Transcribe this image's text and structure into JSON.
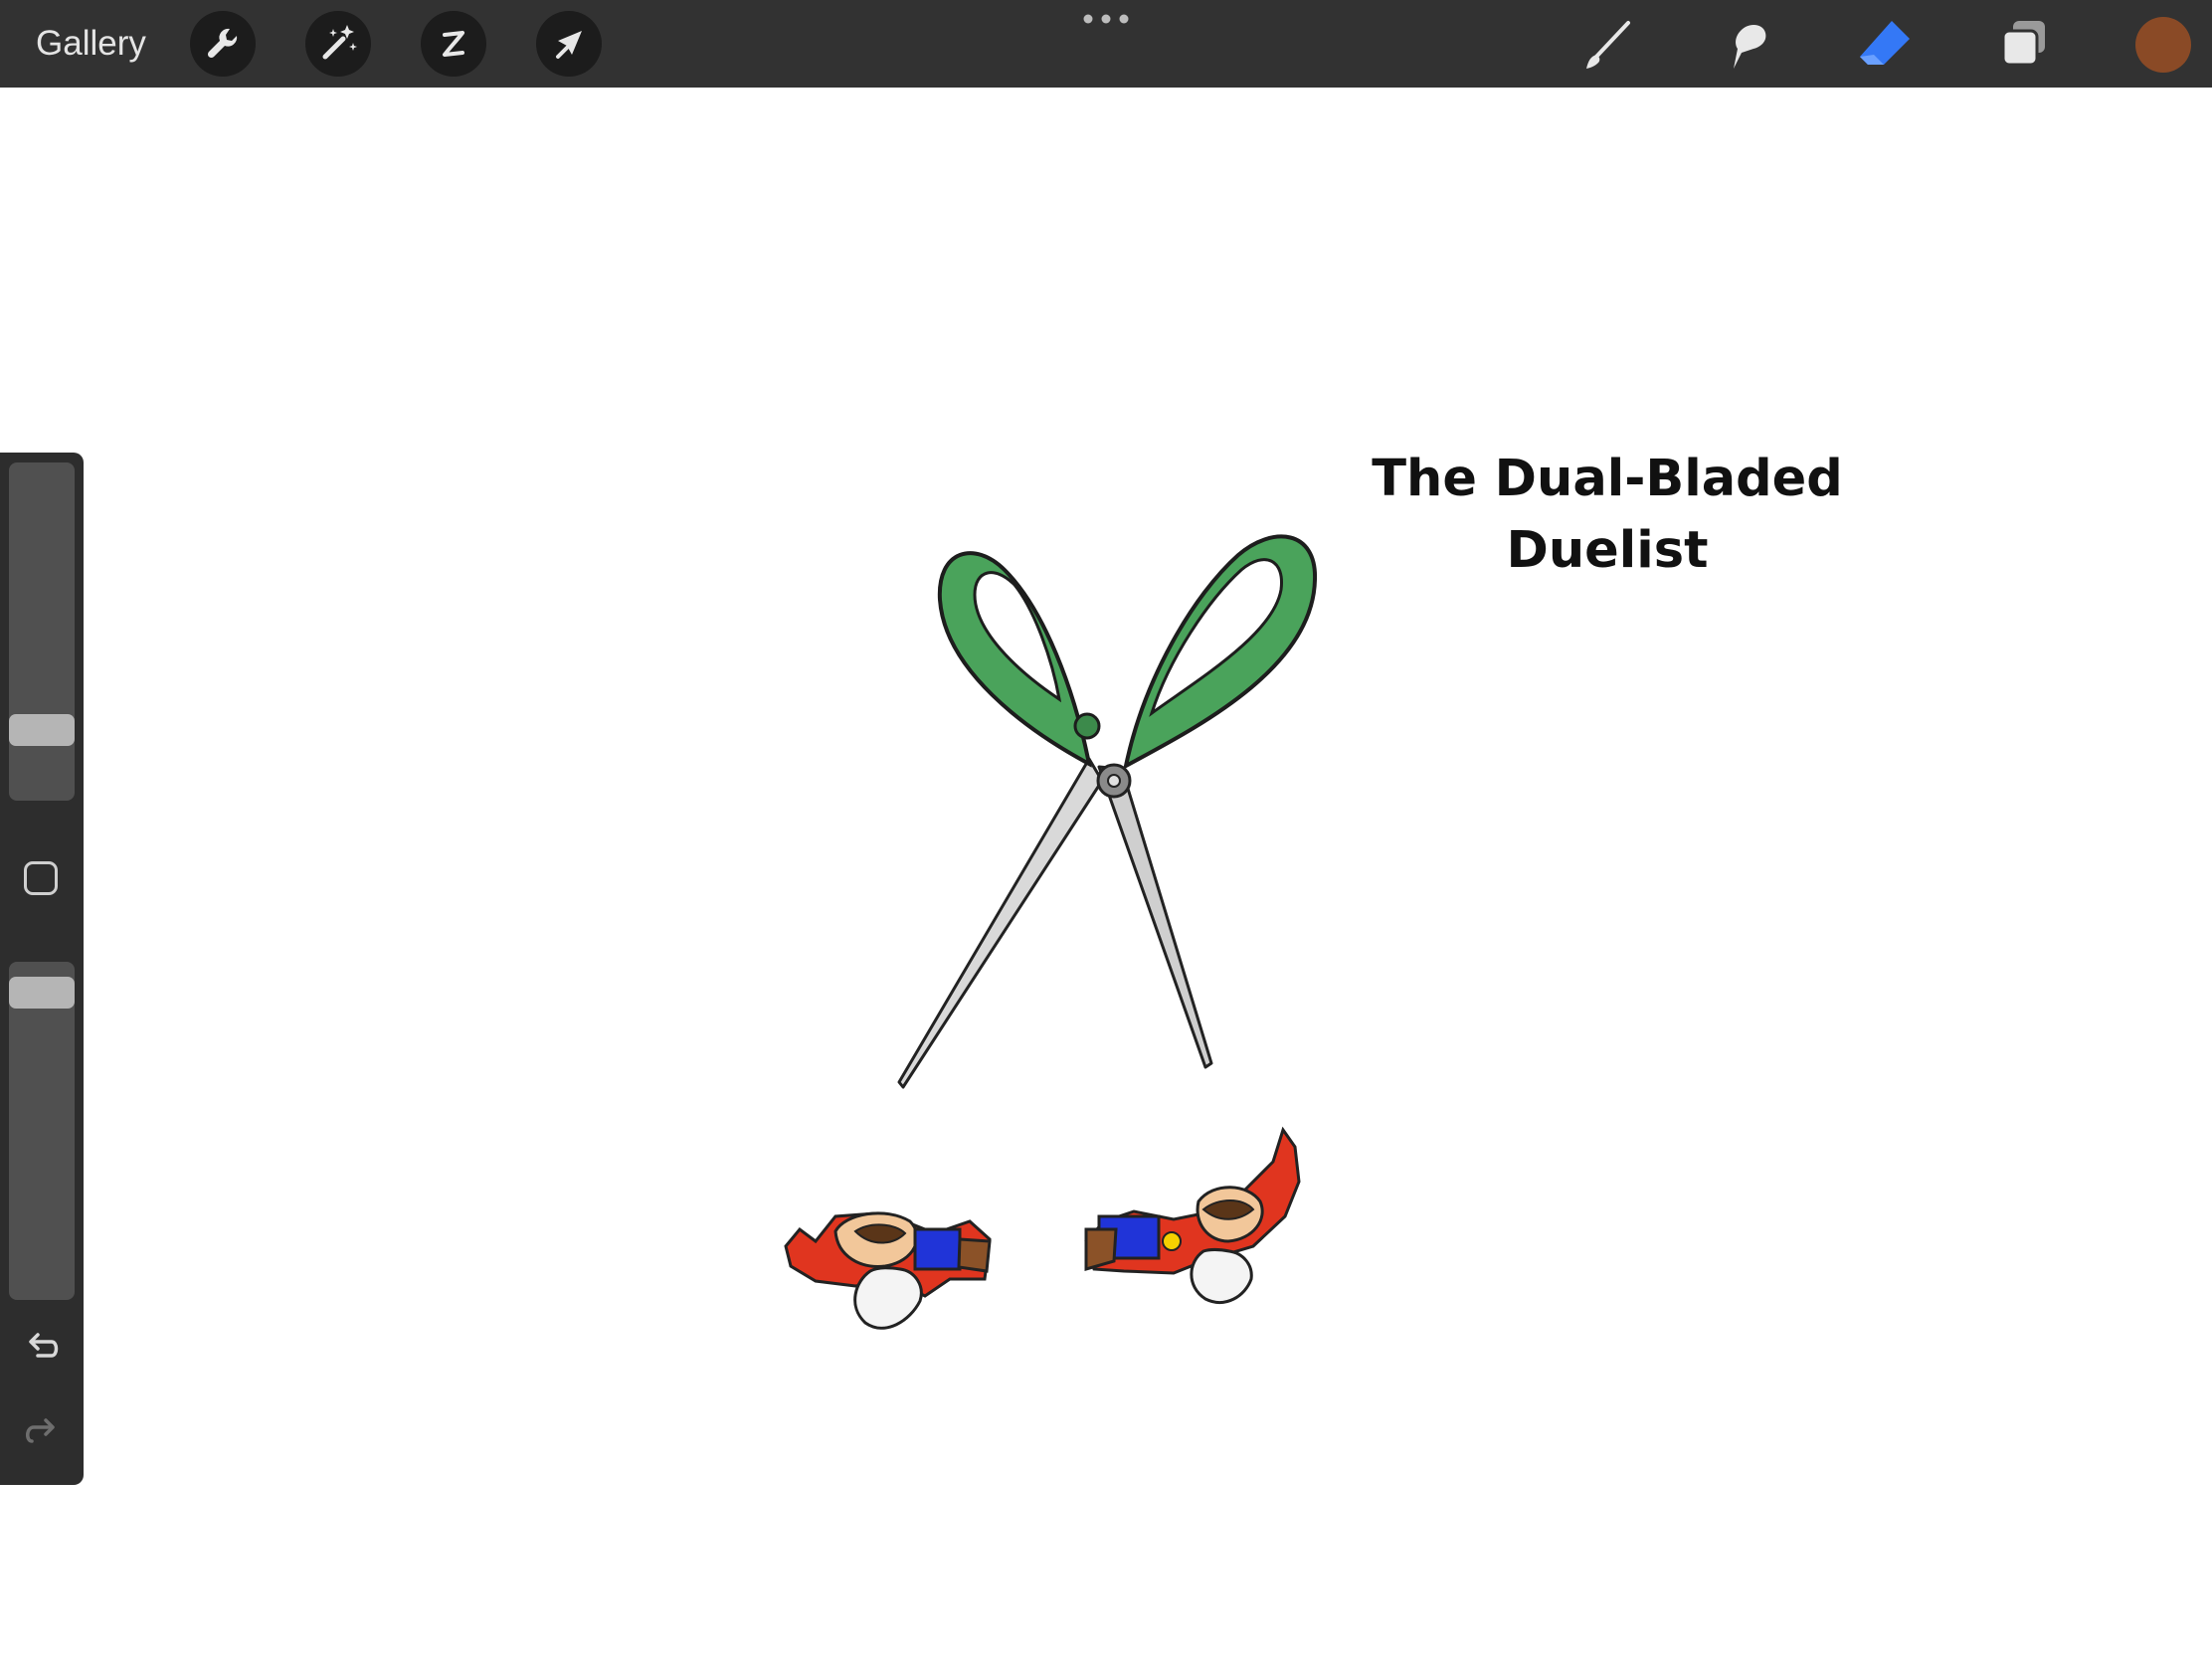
{
  "topbar": {
    "gallery_label": "Gallery",
    "left_tools": [
      {
        "name": "actions",
        "icon": "wrench-icon"
      },
      {
        "name": "adjustments",
        "icon": "magic-wand-icon"
      },
      {
        "name": "selection",
        "icon": "selection-s-icon"
      },
      {
        "name": "transform",
        "icon": "arrow-cursor-icon"
      }
    ],
    "more_icon": "ellipsis-icon",
    "right_tools": [
      {
        "name": "brush",
        "icon": "brush-icon",
        "active": false
      },
      {
        "name": "smudge",
        "icon": "smudge-finger-icon",
        "active": false
      },
      {
        "name": "eraser",
        "icon": "eraser-icon",
        "active": true
      },
      {
        "name": "layers",
        "icon": "layers-icon",
        "active": false
      }
    ],
    "current_color": "#8a4a26"
  },
  "canvas": {
    "title_line1": "The Dual-Bladed",
    "title_line2": "Duelist",
    "artwork": [
      {
        "name": "green scissors",
        "icon": "scissors-illustration"
      },
      {
        "name": "cut mario figure",
        "icon": "mario-halves-illustration"
      }
    ]
  },
  "sidebar": {
    "brush_size_level": 0.18,
    "opacity_level": 0.95,
    "modify_icon": "square-outline-icon",
    "undo_icon": "undo-arrow-icon",
    "redo_icon": "redo-arrow-icon"
  },
  "colors": {
    "toolbar_bg": "#323232",
    "accent_blue": "#3478f6",
    "scissors_green": "#4aa35b"
  }
}
